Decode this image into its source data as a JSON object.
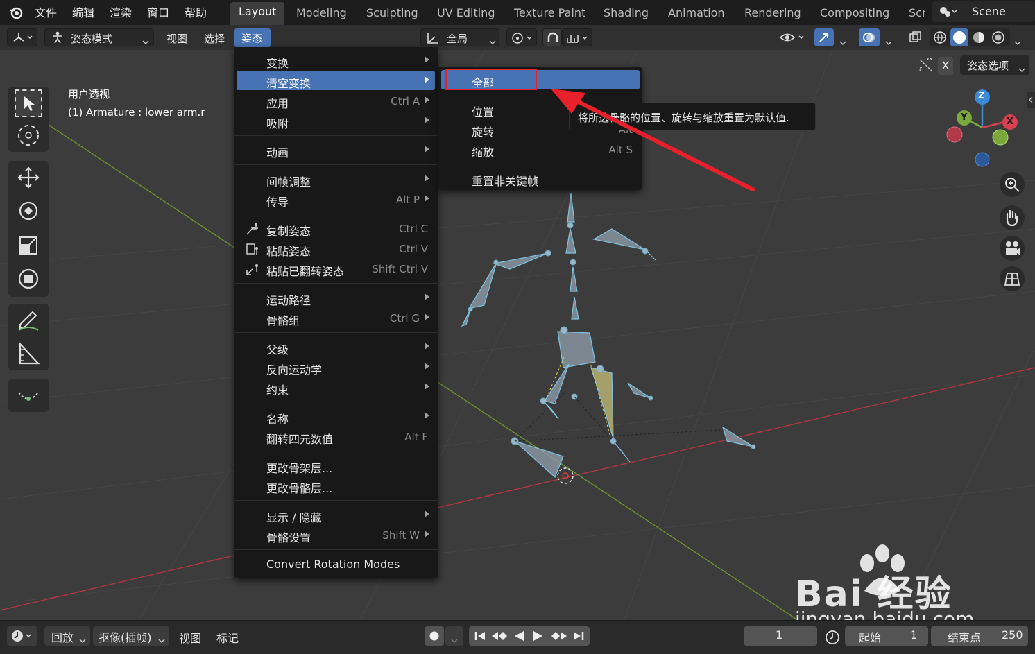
{
  "topbar": {
    "menus": [
      "文件",
      "编辑",
      "渲染",
      "窗口",
      "帮助"
    ],
    "workspaces": [
      "Layout",
      "Modeling",
      "Sculpting",
      "UV Editing",
      "Texture Paint",
      "Shading",
      "Animation",
      "Rendering",
      "Compositing",
      "Scr"
    ],
    "scene": "Scene"
  },
  "header": {
    "mode": "姿态模式",
    "view": "视图",
    "select": "选择",
    "pose": "姿态",
    "transform_orientation": "全局",
    "pose_options": "姿态选项",
    "x_label": "X"
  },
  "viewport": {
    "title": "用户透视",
    "subtitle": "(1) Armature : lower arm.r",
    "gizmo": {
      "z": "Z",
      "y": "Y",
      "x": "X"
    }
  },
  "pose_menu": {
    "items": [
      {
        "label": "变换",
        "shortcut": "",
        "submenu": true
      },
      {
        "label": "清空变换",
        "shortcut": "",
        "submenu": true,
        "highlighted": true
      },
      {
        "label": "应用",
        "shortcut": "Ctrl A",
        "submenu": true
      },
      {
        "label": "吸附",
        "shortcut": "",
        "submenu": true
      },
      {
        "label": "动画",
        "shortcut": "",
        "submenu": true
      },
      {
        "label": "间帧调整",
        "shortcut": "",
        "submenu": true
      },
      {
        "label": "传导",
        "shortcut": "Alt P",
        "submenu": true
      },
      {
        "label": "复制姿态",
        "shortcut": "Ctrl C"
      },
      {
        "label": "粘贴姿态",
        "shortcut": "Ctrl V"
      },
      {
        "label": "粘贴已翻转姿态",
        "shortcut": "Shift Ctrl V"
      },
      {
        "label": "运动路径",
        "shortcut": "",
        "submenu": true
      },
      {
        "label": "骨骼组",
        "shortcut": "Ctrl G",
        "submenu": true
      },
      {
        "label": "父级",
        "shortcut": "",
        "submenu": true
      },
      {
        "label": "反向运动学",
        "shortcut": "",
        "submenu": true
      },
      {
        "label": "约束",
        "shortcut": "",
        "submenu": true
      },
      {
        "label": "名称",
        "shortcut": "",
        "submenu": true
      },
      {
        "label": "翻转四元数值",
        "shortcut": "Alt F"
      },
      {
        "label": "更改骨架层...",
        "shortcut": ""
      },
      {
        "label": "更改骨骼层...",
        "shortcut": ""
      },
      {
        "label": "显示 / 隐藏",
        "shortcut": "",
        "submenu": true
      },
      {
        "label": "骨骼设置",
        "shortcut": "Shift W",
        "submenu": true
      },
      {
        "label": "Convert Rotation Modes",
        "shortcut": ""
      }
    ]
  },
  "clear_submenu": {
    "items": [
      {
        "label": "全部",
        "shortcut": ""
      },
      {
        "label": "位置",
        "shortcut": ""
      },
      {
        "label": "旋转",
        "shortcut": "Alt"
      },
      {
        "label": "缩放",
        "shortcut": "Alt S"
      },
      {
        "label": "重置非关键帧",
        "shortcut": ""
      }
    ]
  },
  "tooltip": "将所选骨骼的位置、旋转与缩放重置为默认值.",
  "timeline": {
    "playback": "回放",
    "keying": "抠像(插帧)",
    "view": "视图",
    "marker": "标记",
    "current_frame": "1",
    "start_label": "起始",
    "start": "1",
    "end_label": "结束点",
    "end": "250"
  },
  "watermark": {
    "brand": "Bai 经验",
    "url": "jingyan.baidu.com"
  },
  "colors": {
    "accent": "#4772b3",
    "annotation": "#e8202a",
    "bone": "#7fc4e0",
    "grid_x": "#b4353f",
    "grid_y": "#6f9330"
  }
}
